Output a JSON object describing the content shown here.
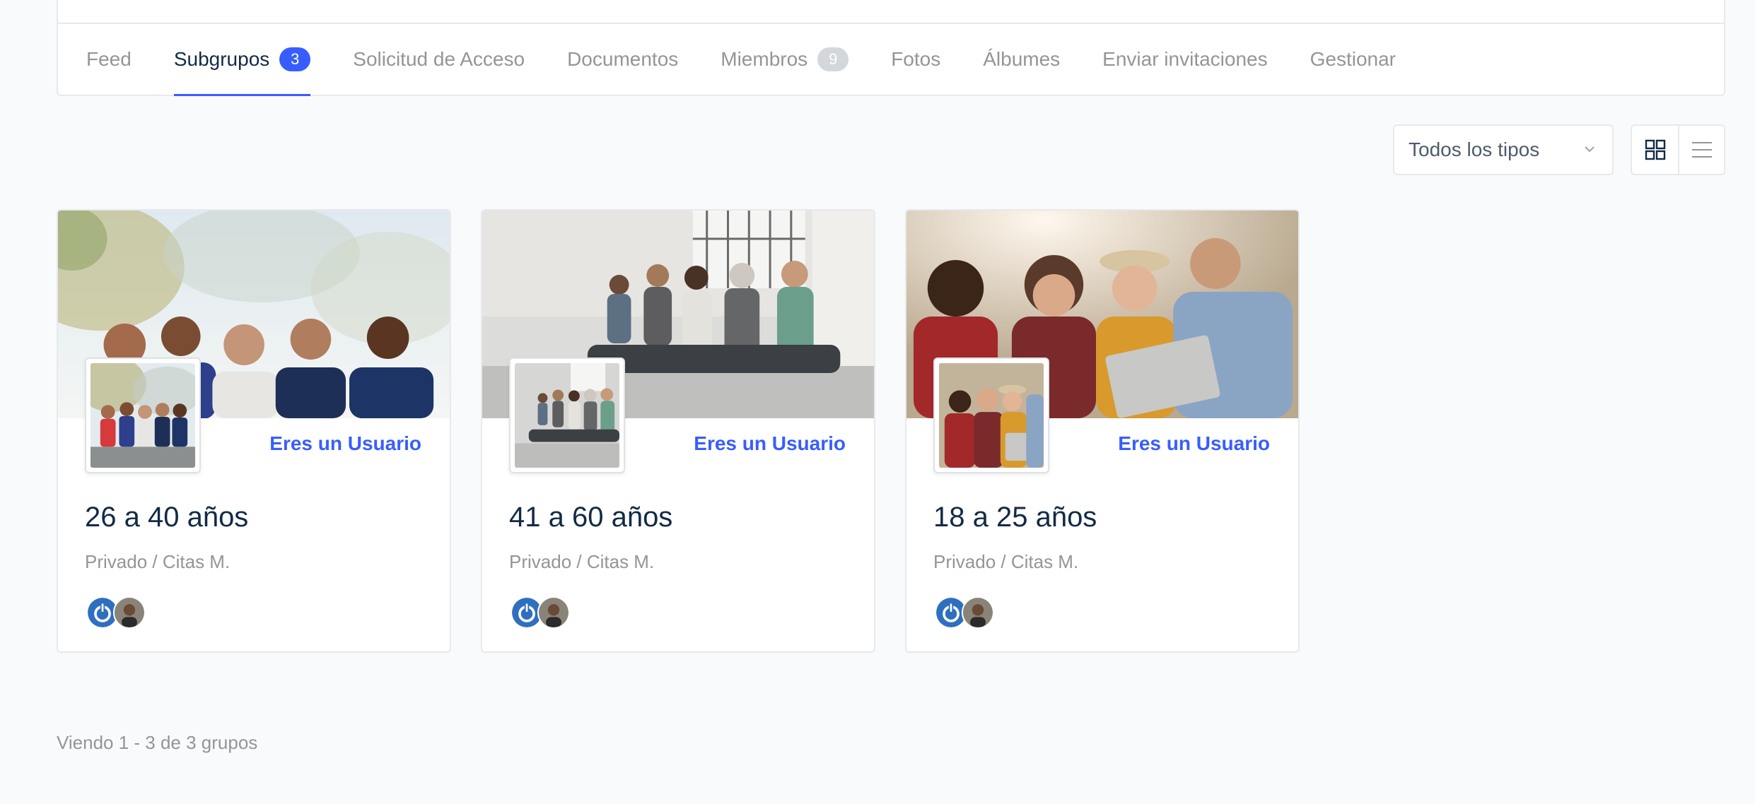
{
  "nav": {
    "tabs": [
      {
        "label": "Feed"
      },
      {
        "label": "Subgrupos",
        "count": "3",
        "active": true
      },
      {
        "label": "Solicitud de Acceso"
      },
      {
        "label": "Documentos"
      },
      {
        "label": "Miembros",
        "count": "9"
      },
      {
        "label": "Fotos"
      },
      {
        "label": "Álbumes"
      },
      {
        "label": "Enviar invitaciones"
      },
      {
        "label": "Gestionar"
      }
    ]
  },
  "filters": {
    "type_select": "Todos los tipos",
    "view_grid_icon": "grid-icon",
    "view_list_icon": "list-icon"
  },
  "groups": [
    {
      "title": "26 a 40 años",
      "role": "Eres un Usuario",
      "meta": "Privado / Citas M."
    },
    {
      "title": "41 a 60 años",
      "role": "Eres un Usuario",
      "meta": "Privado / Citas M."
    },
    {
      "title": "18 a 25 años",
      "role": "Eres un Usuario",
      "meta": "Privado / Citas M."
    }
  ],
  "colors": {
    "accent": "#385dff",
    "text_dark": "#122b46",
    "text_muted": "#939597",
    "border": "#e7e9ec",
    "background": "#f9fafc"
  },
  "pagination": {
    "summary": "Viendo 1 - 3 de 3 grupos"
  }
}
